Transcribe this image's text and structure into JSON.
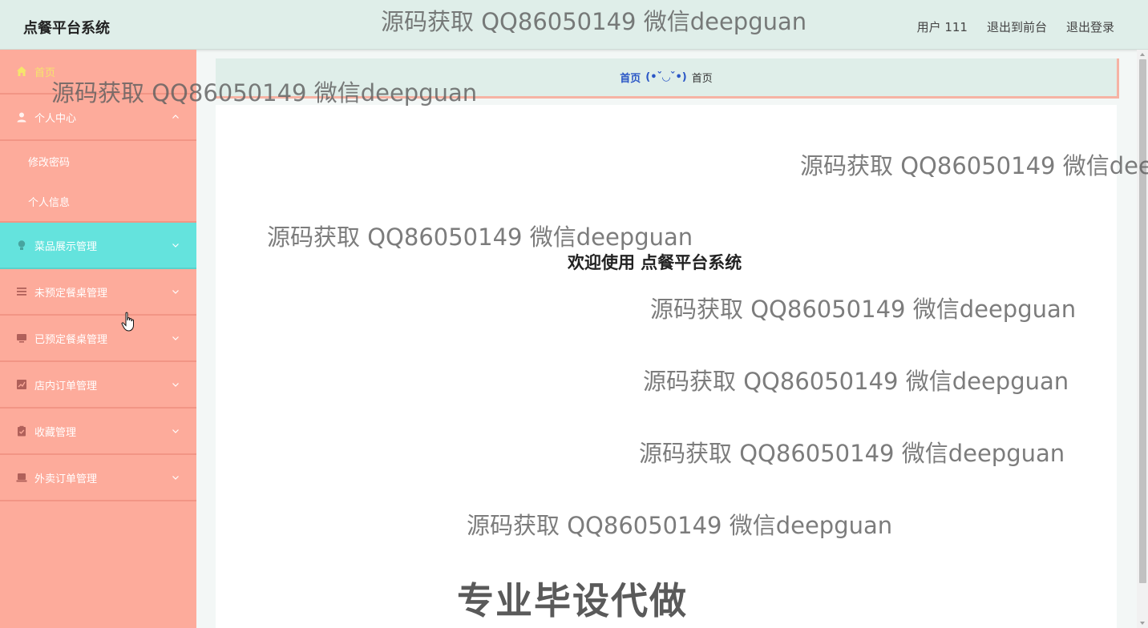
{
  "header": {
    "brand": "点餐平台系统",
    "user_label": "用户 111",
    "exit_front_label": "退出到前台",
    "logout_label": "退出登录"
  },
  "sidebar": {
    "home": "首页",
    "personal_center": "个人中心",
    "personal_sub": [
      "修改密码",
      "个人信息"
    ],
    "items": [
      {
        "label": "菜品展示管理",
        "icon": "bulb-icon"
      },
      {
        "label": "未预定餐桌管理",
        "icon": "list-icon"
      },
      {
        "label": "已预定餐桌管理",
        "icon": "monitor-icon"
      },
      {
        "label": "店内订单管理",
        "icon": "chart-icon"
      },
      {
        "label": "收藏管理",
        "icon": "clipboard-icon"
      },
      {
        "label": "外卖订单管理",
        "icon": "laptop-icon"
      }
    ]
  },
  "breadcrumb": {
    "home": "首页",
    "separator": "(•ˇ◡ˇ•)",
    "current": "首页"
  },
  "main": {
    "welcome": "欢迎使用 点餐平台系统"
  },
  "watermark": {
    "text": "源码获取 QQ86050149 微信deepguan",
    "bottom_text": "专业毕设代做"
  },
  "colors": {
    "sidebar_bg": "#fdab9b",
    "sidebar_active": "#64e3dd",
    "header_bg": "#dfeee9",
    "home_text": "#f5e56b",
    "breadcrumb_link": "#2a56c6"
  }
}
